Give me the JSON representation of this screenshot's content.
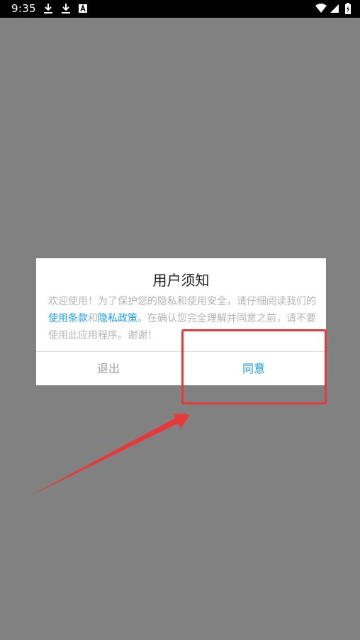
{
  "status_bar": {
    "time": "9:35",
    "left_icons": [
      "download-icon",
      "download-icon",
      "font-a-icon"
    ],
    "right_icons": [
      "wifi-icon",
      "signal-icon",
      "battery-icon"
    ]
  },
  "dialog": {
    "title": "用户须知",
    "body_prefix": "欢迎使用！为了保护您的隐私和使用安全，请仔细阅读我们的",
    "terms_link": "使用条款",
    "and_text": "和",
    "privacy_link": "隐私政策",
    "body_suffix": "。在确认您完全理解并同意之前，请不要使用此应用程序。谢谢！",
    "exit_label": "退出",
    "agree_label": "同意"
  },
  "colors": {
    "overlay": "#818181",
    "link": "#1a9de4",
    "highlight": "#e8393a"
  }
}
